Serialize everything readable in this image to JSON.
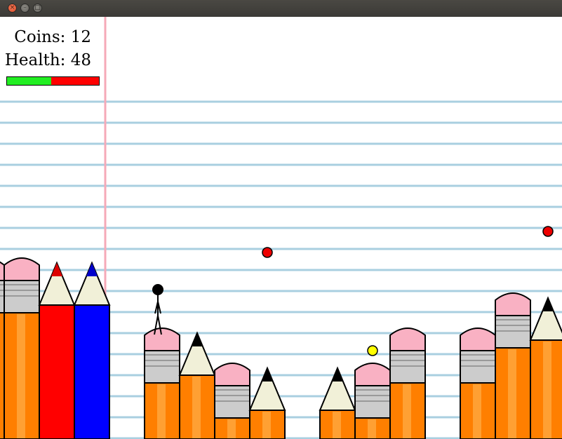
{
  "window": {
    "title": ""
  },
  "hud": {
    "coins_text": "Coins: 12",
    "health_text": "Health: 48",
    "health_fraction": 0.48,
    "health_color": "#22ee22",
    "damage_color": "#ff0000"
  },
  "palette": {
    "ruled_line": "#a9cfe0",
    "margin_line": "#f5aab8",
    "pencil_body": "#ff7f00",
    "pencil_stripe": "#ffa033",
    "eraser": "#f9b1c3",
    "ferrule": "#cccccc",
    "wood": "#f1f0d8",
    "lead": "#000000",
    "coin": "#ffff00",
    "hazard": "#ee0000"
  },
  "icons": [
    "close-icon",
    "minimize-icon",
    "maximize-icon"
  ]
}
